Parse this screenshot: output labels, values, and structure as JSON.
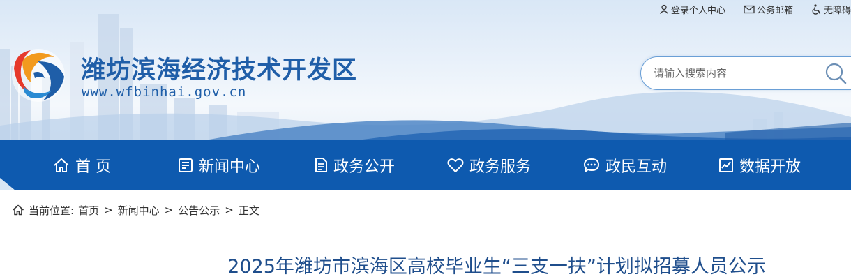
{
  "toplinks": [
    {
      "icon": "user-icon",
      "label": "登录个人中心"
    },
    {
      "icon": "mail-icon",
      "label": "公务邮箱"
    },
    {
      "icon": "accessibility-icon",
      "label": "无障碍"
    }
  ],
  "site": {
    "title": "潍坊滨海经济技术开发区",
    "url": "www.wfbinhai.gov.cn"
  },
  "search": {
    "placeholder": "请输入搜索内容",
    "value": ""
  },
  "nav": {
    "items": [
      {
        "icon": "home-icon",
        "label": "首 页"
      },
      {
        "icon": "news-icon",
        "label": "新闻中心"
      },
      {
        "icon": "document-icon",
        "label": "政务公开"
      },
      {
        "icon": "heart-icon",
        "label": "政务服务"
      },
      {
        "icon": "chat-icon",
        "label": "政民互动"
      },
      {
        "icon": "chart-icon",
        "label": "数据开放"
      }
    ]
  },
  "breadcrumb": {
    "prefix": "当前位置:",
    "items": [
      "首页",
      "新闻中心",
      "公告公示",
      "正文"
    ],
    "separator": ">"
  },
  "article": {
    "title": "2025年潍坊市滨海区高校毕业生“三支一扶”计划拟招募人员公示"
  },
  "colors": {
    "brand_blue": "#0e5aaf",
    "title_blue": "#1f5ea8",
    "article_title": "#1f4e8c"
  }
}
